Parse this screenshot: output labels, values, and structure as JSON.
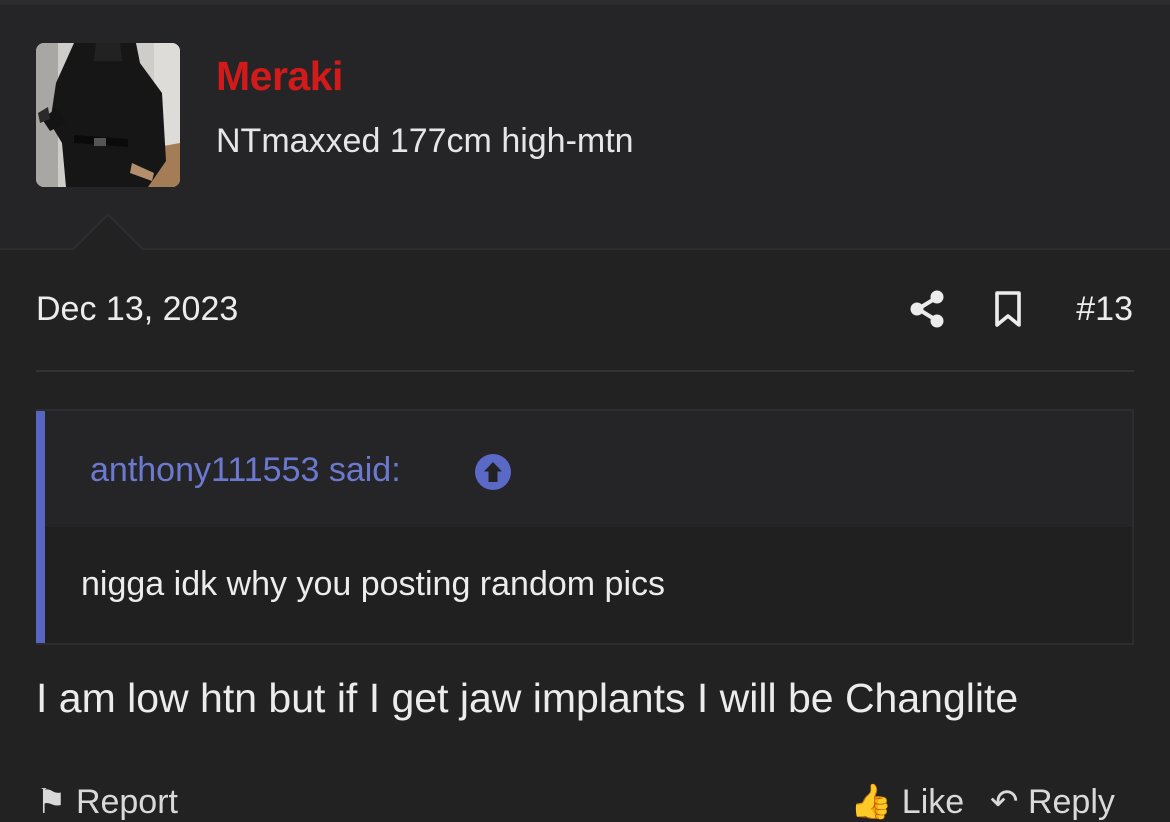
{
  "post": {
    "author": {
      "name": "Meraki",
      "title": "NTmaxxed 177cm high-mtn",
      "name_color": "#d21a1a"
    },
    "date": "Dec 13, 2023",
    "number": "#13",
    "quote": {
      "author_line": "anthony111553 said:",
      "text": "nigga idk why you posting random pics",
      "accent_color": "#5865c2"
    },
    "body": "I am low htn but if I get jaw implants I will be Changlite"
  },
  "actions": {
    "report": "Report",
    "like": "Like",
    "reply": "Reply"
  },
  "icons": {
    "share": "share-icon",
    "bookmark": "bookmark-icon",
    "quote_jump": "arrow-up-circle-icon",
    "report": "flag-icon",
    "like": "thumbs-up-icon",
    "reply": "reply-icon"
  }
}
